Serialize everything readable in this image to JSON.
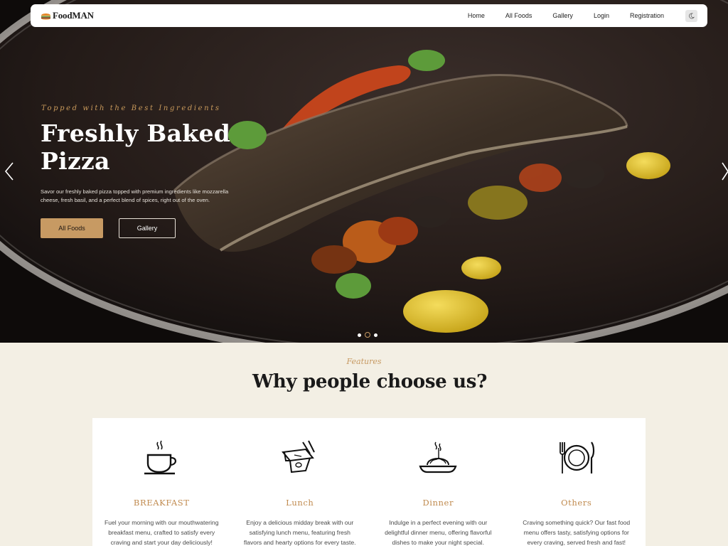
{
  "brand": {
    "name": "FoodMAN",
    "accent": "#c79a63"
  },
  "nav": {
    "links": [
      "Home",
      "All Foods",
      "Gallery",
      "Login",
      "Registration"
    ],
    "theme_icon": "moon-icon"
  },
  "hero": {
    "tagline": "Topped with the Best Ingredients",
    "title": "Freshly Baked Pizza",
    "description": "Savor our freshly baked pizza topped with premium ingredients like mozzarella cheese, fresh basil, and a perfect blend of spices, right out of the oven.",
    "primary_button": "All Foods",
    "secondary_button": "Gallery",
    "prev_icon": "chevron-left-icon",
    "next_icon": "chevron-right-icon",
    "slide_count": 3,
    "active_slide": 2
  },
  "features": {
    "kicker": "Features",
    "heading": "Why people choose us?",
    "items": [
      {
        "icon": "coffee-cup-icon",
        "title": "BREAKFAST",
        "description": "Fuel your morning with our mouthwatering breakfast menu, crafted to satisfy every craving and start your day deliciously!"
      },
      {
        "icon": "takeout-box-icon",
        "title": "Lunch",
        "description": "Enjoy a delicious midday break with our satisfying lunch menu, featuring fresh flavors and hearty options for every taste."
      },
      {
        "icon": "pasta-plate-icon",
        "title": "Dinner",
        "description": "Indulge in a perfect evening with our delightful dinner menu, offering flavorful dishes to make your night special."
      },
      {
        "icon": "plate-cutlery-icon",
        "title": "Others",
        "description": "Craving something quick? Our fast food menu offers tasty, satisfying options for every craving, served fresh and fast!"
      }
    ]
  }
}
